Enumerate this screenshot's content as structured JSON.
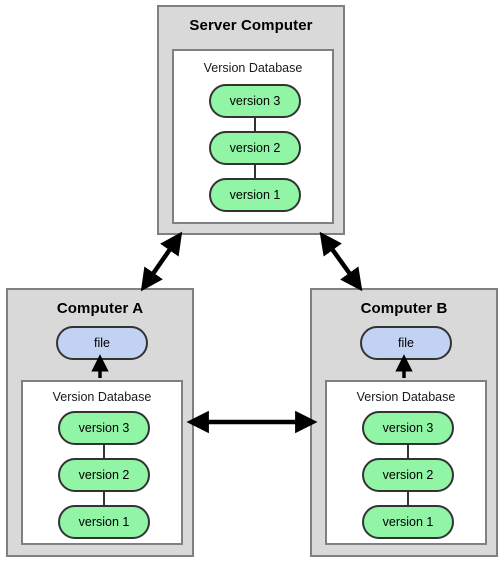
{
  "diagram": {
    "type": "centralized-version-control",
    "background_color": "#ffffff",
    "colors": {
      "machine_fill": "#d9d9d9",
      "machine_border": "#808080",
      "database_fill": "#ffffff",
      "version_pill_fill": "#90f5a5",
      "file_pill_fill": "#c2d2f2",
      "pill_border": "#333333",
      "arrow_color": "#000000"
    }
  },
  "server": {
    "title": "Server Computer",
    "database": {
      "title": "Version Database",
      "versions": [
        {
          "label": "version 3"
        },
        {
          "label": "version 2"
        },
        {
          "label": "version 1"
        }
      ]
    }
  },
  "computer_a": {
    "title": "Computer A",
    "file": {
      "label": "file"
    },
    "database": {
      "title": "Version Database",
      "versions": [
        {
          "label": "version 3"
        },
        {
          "label": "version 2"
        },
        {
          "label": "version 1"
        }
      ]
    }
  },
  "computer_b": {
    "title": "Computer B",
    "file": {
      "label": "file"
    },
    "database": {
      "title": "Version Database",
      "versions": [
        {
          "label": "version 3"
        },
        {
          "label": "version 2"
        },
        {
          "label": "version 1"
        }
      ]
    }
  },
  "connections": [
    {
      "name": "server-to-computer-a",
      "style": "double-headed-arrow",
      "orientation": "diagonal"
    },
    {
      "name": "server-to-computer-b",
      "style": "double-headed-arrow",
      "orientation": "diagonal"
    },
    {
      "name": "computer-a-to-computer-b",
      "style": "double-headed-arrow",
      "orientation": "horizontal"
    },
    {
      "name": "database-a-to-file-a",
      "style": "single-headed-arrow",
      "orientation": "vertical-up"
    },
    {
      "name": "database-b-to-file-b",
      "style": "single-headed-arrow",
      "orientation": "vertical-up"
    }
  ]
}
